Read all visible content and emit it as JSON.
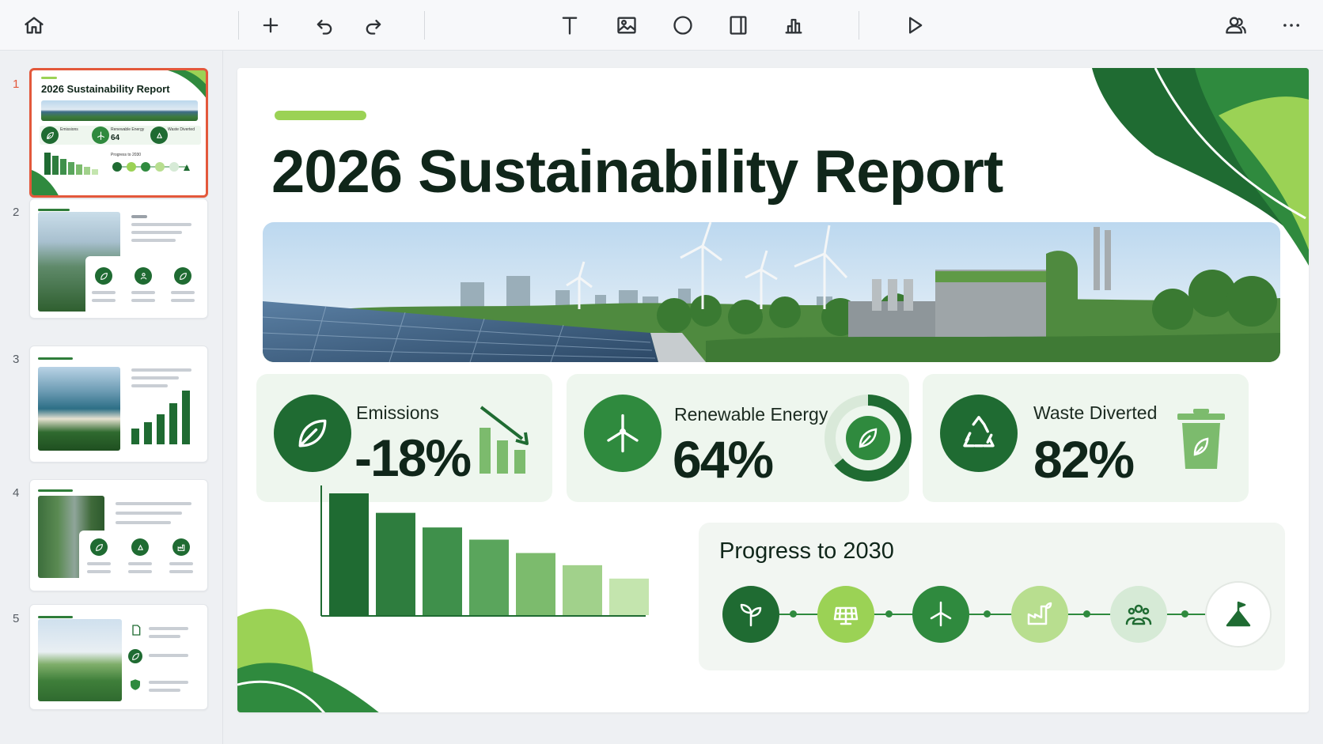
{
  "toolbar": {
    "buttons": [
      "home-icon",
      "add-icon",
      "undo-icon",
      "redo-icon",
      "text-icon",
      "image-icon",
      "shape-icon",
      "layout-icon",
      "chart-icon",
      "play-icon",
      "users-icon",
      "more-icon"
    ]
  },
  "sidebar": {
    "slides": [
      {
        "number": "1",
        "active": true,
        "title": "2026 Sustainability Report"
      },
      {
        "number": "2",
        "active": false
      },
      {
        "number": "3",
        "active": false
      },
      {
        "number": "4",
        "active": false
      },
      {
        "number": "5",
        "active": false
      }
    ],
    "thumb1_mini": {
      "label_a": "Emissions",
      "label_b": "Renewable Energy",
      "label_c": "Waste Diverted",
      "value_b": "64",
      "progress": "Progress to 2030"
    }
  },
  "slide": {
    "title": "2026 Sustainability Report",
    "stats": [
      {
        "label": "Emissions",
        "value": "-18%",
        "icon": "leaf-icon"
      },
      {
        "label": "Renewable Energy",
        "value": "64%",
        "icon": "wind-turbine-icon",
        "ring_fraction": 0.64
      },
      {
        "label": "Waste Diverted",
        "value": "82%",
        "icon": "recycle-icon"
      }
    ],
    "progress": {
      "title": "Progress to 2030",
      "steps": [
        "sprout-icon",
        "solar-panel-icon",
        "wind-turbine-icon",
        "factory-icon",
        "community-icon",
        "goal-flag-icon"
      ]
    }
  },
  "colors": {
    "dark_green": "#1f6b32",
    "mid_green": "#2f8a3e",
    "lime": "#9bd255",
    "active_outline": "#e3583b"
  },
  "chart_data": {
    "type": "bar",
    "categories": [
      "",
      "",
      "",
      "",
      "",
      "",
      ""
    ],
    "values": [
      100,
      84,
      72,
      62,
      51,
      41,
      30
    ],
    "title": "",
    "xlabel": "",
    "ylabel": "",
    "ylim": [
      0,
      100
    ],
    "colors": [
      "#1f6b32",
      "#2e7d3e",
      "#3f904b",
      "#5aa55c",
      "#7cbb6d",
      "#a1d18b",
      "#c4e5ae"
    ]
  }
}
